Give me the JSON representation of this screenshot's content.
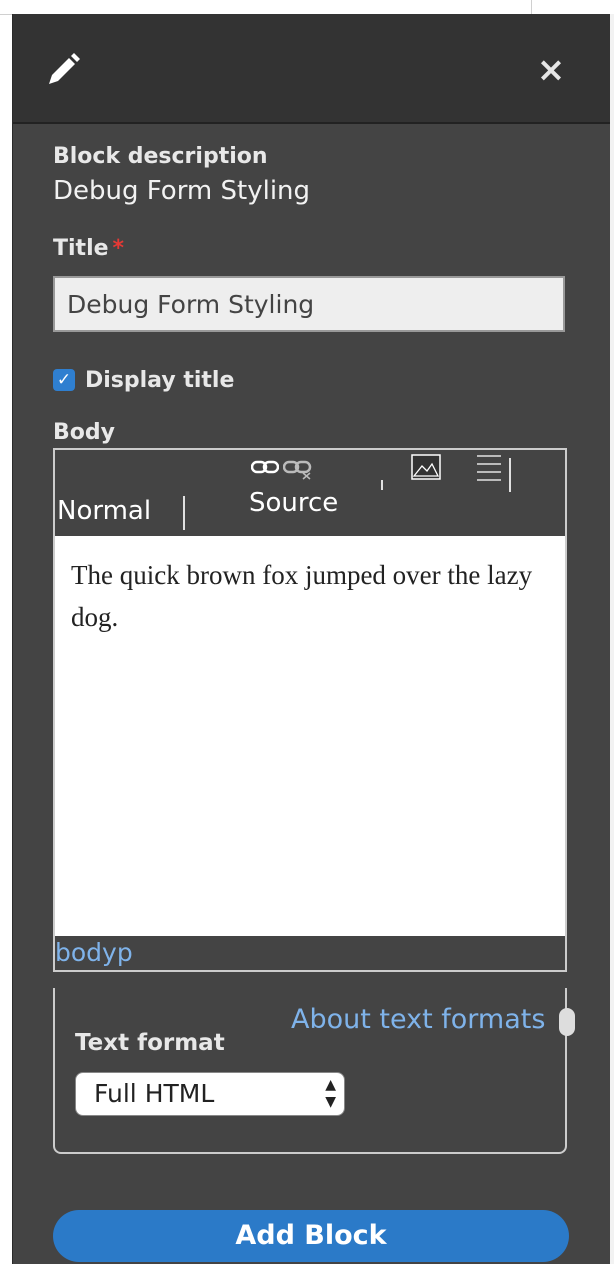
{
  "header": {
    "edit_icon": "pencil-icon",
    "close_label": "×"
  },
  "form": {
    "description_label": "Block description",
    "description_value": "Debug Form Styling",
    "title_label": "Title",
    "required_marker": "*",
    "title_value": "Debug Form Styling",
    "display_title_checked": true,
    "display_title_label": "Display title",
    "body_label": "Body"
  },
  "editor": {
    "format_select_label": "Normal",
    "source_label": "Source",
    "content": "The quick brown fox jumped over the lazy dog.",
    "element_path": "bodyp",
    "toolbar_icons": [
      "link-icon",
      "unlink-icon",
      "image-icon",
      "blockquote-icon"
    ]
  },
  "text_format": {
    "about_link": "About text formats",
    "label": "Text format",
    "selected": "Full HTML"
  },
  "actions": {
    "add_block_label": "Add Block"
  },
  "colors": {
    "tray_background": "#444444",
    "header_background": "#333333",
    "accent_blue": "#2b7ac8",
    "link_blue": "#7fb3ea",
    "required_red": "#e53935"
  }
}
